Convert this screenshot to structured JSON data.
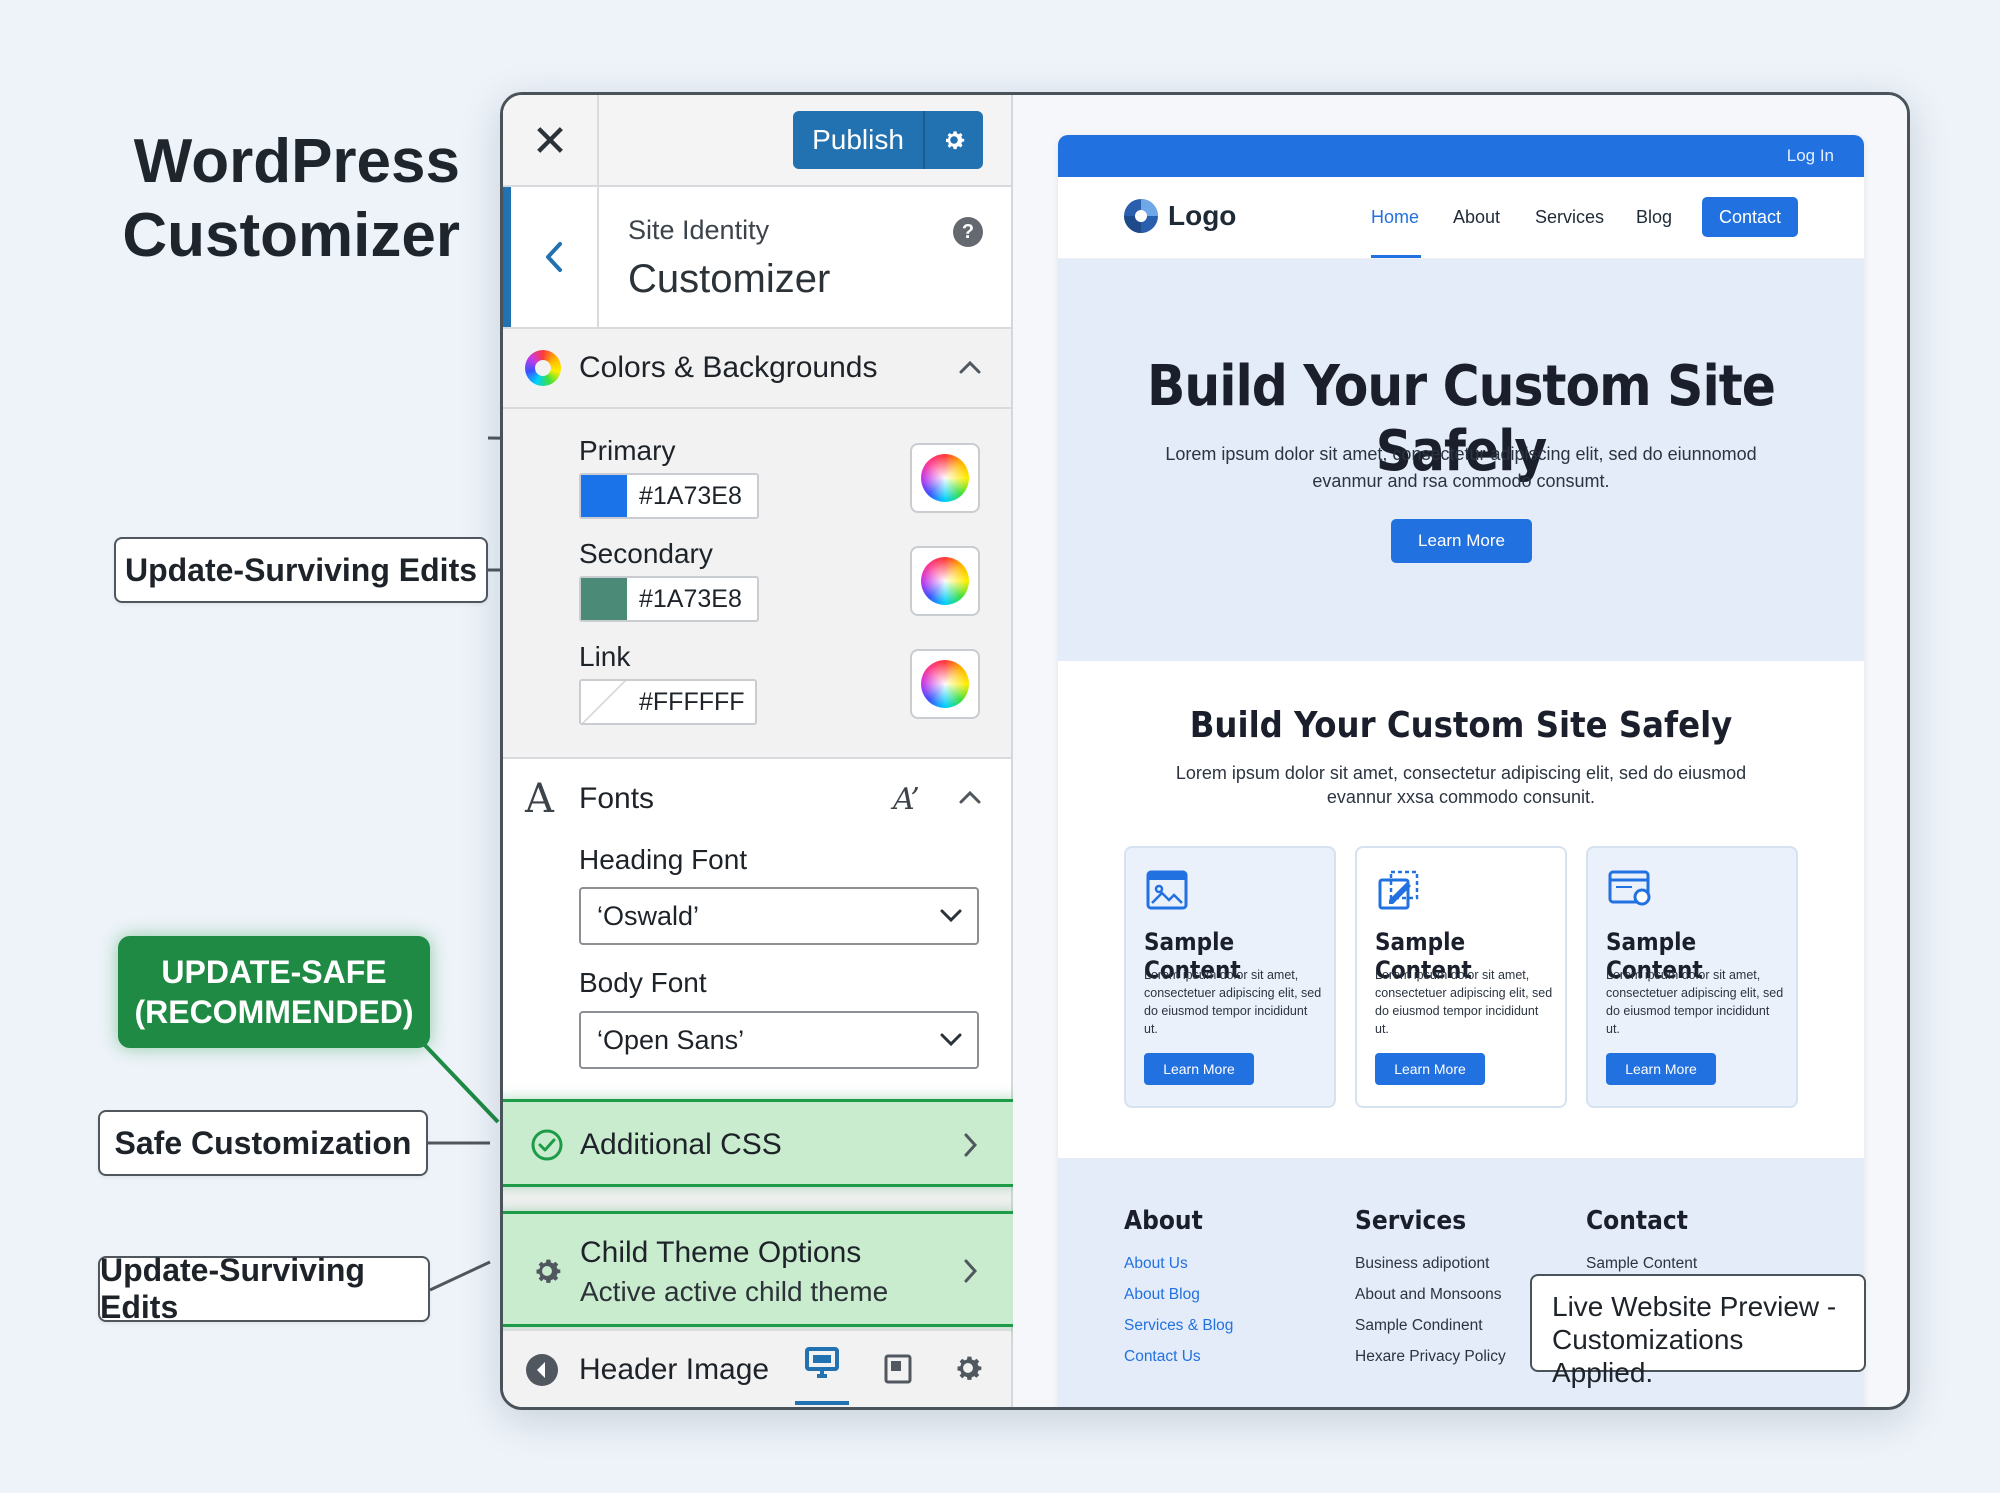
{
  "page_title_line1": "WordPress",
  "page_title_line2": "Customizer",
  "panel": {
    "close_label": "✕",
    "publish_label": "Publish",
    "site_identity_sub": "Site Identity",
    "site_identity_title": "Customizer",
    "help_label": "?",
    "colors_section": {
      "title": "Colors & Backgrounds",
      "items": [
        {
          "label": "Primary",
          "hex": "#1A73E8",
          "swatch": "#1a73e8"
        },
        {
          "label": "Secondary",
          "hex": "#1A73E8",
          "swatch": "#4a8a76"
        },
        {
          "label": "Link",
          "hex": "#FFFFFF",
          "swatch": "#ffffff"
        }
      ]
    },
    "fonts_section": {
      "title": "Fonts",
      "heading_font_label": "Heading Font",
      "heading_font_value": "‘Oswald’",
      "body_font_label": "Body Font",
      "body_font_value": "‘Open Sans’"
    },
    "additional_css_label": "Additional CSS",
    "child_theme_title": "Child Theme Options",
    "child_theme_sub": "Active active child theme",
    "header_image_label": "Header Image"
  },
  "preview": {
    "login_label": "Log In",
    "logo_text": "Logo",
    "nav": [
      "Home",
      "About",
      "Services",
      "Blog"
    ],
    "contact_label": "Contact",
    "hero_title": "Build Your Custom Site Safely",
    "hero_text": "Lorem ipsum dolor sit amet, consectetur adipiscing elit, sed do eiunnomod evanmur and rsa commodo consumt.",
    "hero_button": "Learn More",
    "section2_title": "Build Your Custom Site Safely",
    "section2_text": "Lorem ipsum dolor sit amet, consectetur adipiscing elit, sed do eiusmod evannur xxsa commodo consunit.",
    "cards": [
      {
        "title": "Sample Content",
        "text": "Lorem ipsum dolor sit amet, consectetuer adipiscing elit, sed do eiusmod tempor incididunt ut.",
        "button": "Learn More"
      },
      {
        "title": "Sample Content",
        "text": "Lorem ipsum dolor sit amet, consectetuer adipiscing elit, sed do eiusmod tempor incididunt ut.",
        "button": "Learn More"
      },
      {
        "title": "Sample Content",
        "text": "Lorem ipsum dolor sit amet, consectetuer adipiscing elit, sed do eiusmod tempor incididunt ut.",
        "button": "Learn More"
      }
    ],
    "footer": {
      "about": {
        "title": "About",
        "links": [
          "About Us",
          "About Blog",
          "Services & Blog",
          "Contact Us"
        ]
      },
      "services": {
        "title": "Services",
        "links": [
          "Business adipotiont",
          "About and Monsoons",
          "Sample Condinent",
          "Hexare Privacy Policy"
        ]
      },
      "contact": {
        "title": "Contact",
        "links": [
          "Sample Content"
        ]
      }
    }
  },
  "callouts": {
    "update_surviving_1": "Update-Surviving Edits",
    "recommended_line1": "UPDATE-SAFE",
    "recommended_line2": "(RECOMMENDED)",
    "safe_customization": "Safe Customization",
    "update_surviving_2": "Update-Surviving Edits",
    "live_preview_line1": "Live Website Preview -",
    "live_preview_line2": "Customizations Applied."
  },
  "colors": {
    "wp_blue": "#2271b1",
    "site_blue": "#2271e0",
    "green_accent": "#1e9b48",
    "green_badge": "#1e8a44"
  }
}
